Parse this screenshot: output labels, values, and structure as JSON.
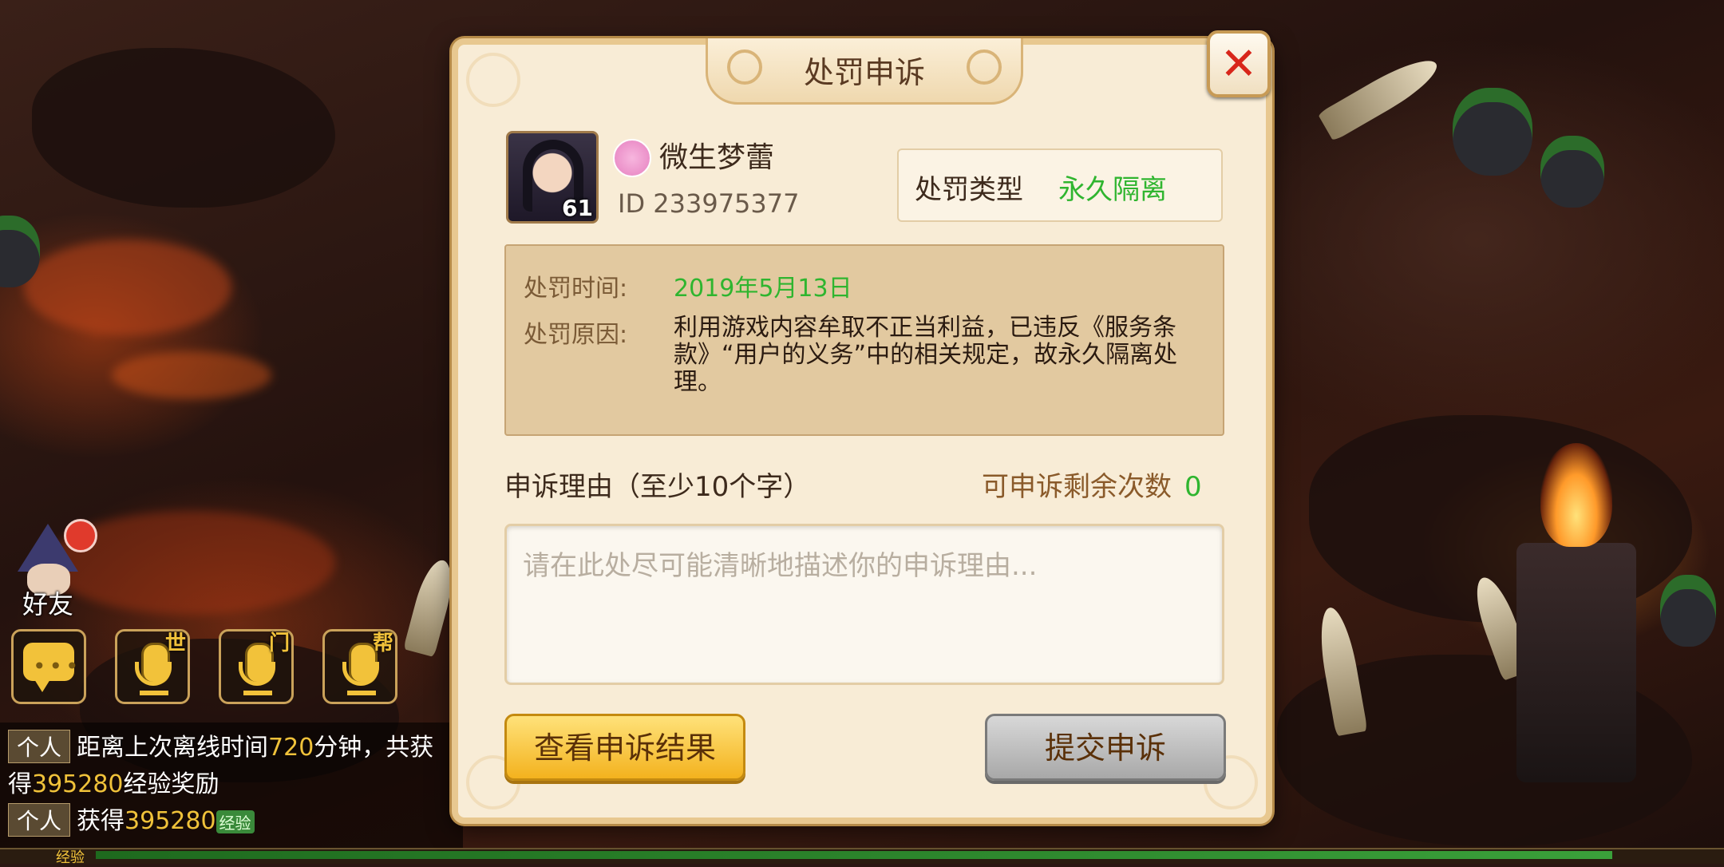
{
  "dialog": {
    "title": "处罚申诉",
    "close_icon": "close-icon"
  },
  "player": {
    "name": "微生梦蕾",
    "id_text": "ID 233975377",
    "level": "61",
    "gender_icon": "female-icon"
  },
  "punishment": {
    "type_label": "处罚类型",
    "type_value": "永久隔离",
    "time_label": "处罚时间:",
    "time_value": "2019年5月13日",
    "reason_label": "处罚原因:",
    "reason_value": "利用游戏内容牟取不正当利益，已违反《服务条款》“用户的义务”中的相关规定，故永久隔离处理。"
  },
  "appeal": {
    "reason_label": "申诉理由（至少10个字）",
    "remaining_label": "可申诉剩余次数",
    "remaining_count": "0",
    "placeholder": "请在此处尽可能清晰地描述你的申诉理由...",
    "value": ""
  },
  "buttons": {
    "view_result": "查看申诉结果",
    "submit": "提交申诉"
  },
  "hud": {
    "friends_label": "好友",
    "voice_world_tag": "世",
    "voice_sect_tag": "门",
    "voice_guild_tag": "帮"
  },
  "chat": {
    "line1_channel": "个人",
    "line1_pre": "距离上次离线时间",
    "line1_num": "720",
    "line1_post": "分钟，共获",
    "line2_pre": "得",
    "line2_num": "395280",
    "line2_post": "经验奖励",
    "line3_channel": "个人",
    "line3_pre": "获得",
    "line3_num": "395280",
    "line3_badge": "经验"
  },
  "exp_bar": {
    "label": "经验"
  },
  "colors": {
    "accent_green": "#2fb52f",
    "close_red": "#d8261a",
    "button_yellow": "#f3b21e",
    "button_gray": "#a8a8a8"
  }
}
